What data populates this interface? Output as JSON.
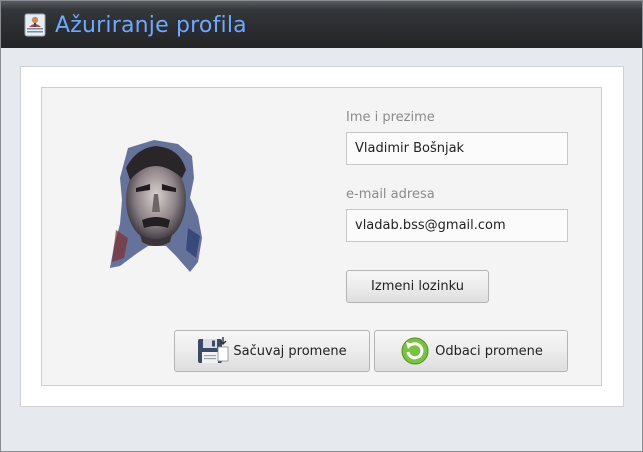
{
  "window": {
    "title": "Ažuriranje profila",
    "icon": "user-profile-icon"
  },
  "form": {
    "name_label": "Ime i prezime",
    "name_value": "Vladimir Bošnjak",
    "email_label": "e-mail adresa",
    "email_value": "vladab.bss@gmail.com",
    "change_password_label": "Izmeni lozinku"
  },
  "actions": {
    "save_label": "Sačuvaj promene",
    "save_icon": "floppy-disk-icon",
    "discard_label": "Odbaci promene",
    "discard_icon": "refresh-icon"
  },
  "colors": {
    "title_text": "#6ea8ff",
    "titlebar_bg": "#2a2c2f"
  }
}
